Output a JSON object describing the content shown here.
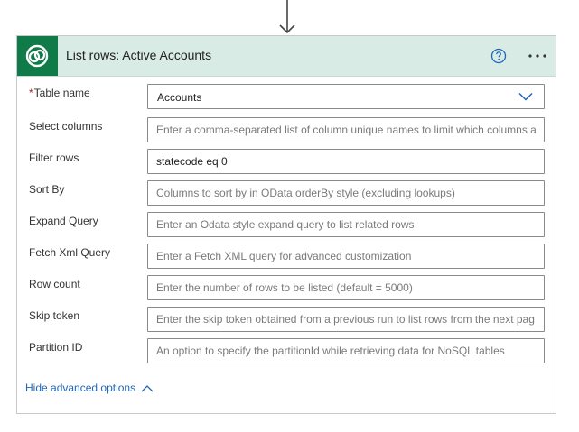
{
  "action": {
    "title": "List rows: Active Accounts",
    "icons": {
      "connector": "dataverse-logo-icon",
      "help": "help-circle-icon",
      "more": "more-ellipsis-icon",
      "flow_arrow": "arrow-down-icon"
    },
    "colors": {
      "header_bg": "#d8ebe4",
      "logo_bg": "#0f7b48",
      "link": "#2266bb",
      "required": "#a4262c"
    }
  },
  "fields": {
    "table_name": {
      "required_marker": "*",
      "label": "Table name",
      "value": "Accounts"
    },
    "select_columns": {
      "label": "Select columns",
      "value": "",
      "placeholder": "Enter a comma-separated list of column unique names to limit which columns a"
    },
    "filter_rows": {
      "label": "Filter rows",
      "value": "statecode eq 0",
      "placeholder": ""
    },
    "sort_by": {
      "label": "Sort By",
      "value": "",
      "placeholder": "Columns to sort by in OData orderBy style (excluding lookups)"
    },
    "expand_query": {
      "label": "Expand Query",
      "value": "",
      "placeholder": "Enter an Odata style expand query to list related rows"
    },
    "fetch_xml_query": {
      "label": "Fetch Xml Query",
      "value": "",
      "placeholder": "Enter a Fetch XML query for advanced customization"
    },
    "row_count": {
      "label": "Row count",
      "value": "",
      "placeholder": "Enter the number of rows to be listed (default = 5000)"
    },
    "skip_token": {
      "label": "Skip token",
      "value": "",
      "placeholder": "Enter the skip token obtained from a previous run to list rows from the next pag"
    },
    "partition_id": {
      "label": "Partition ID",
      "value": "",
      "placeholder": "An option to specify the partitionId while retrieving data for NoSQL tables"
    }
  },
  "advanced": {
    "toggle_label": "Hide advanced options"
  }
}
